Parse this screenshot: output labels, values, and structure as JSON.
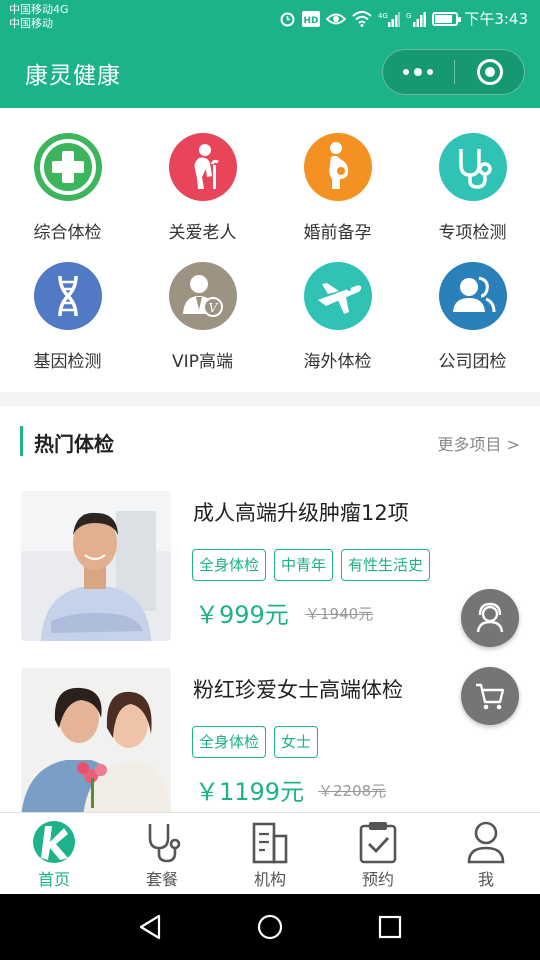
{
  "status_bar": {
    "carrier_line1": "中国移动4G",
    "carrier_line2": "中国移动",
    "time": "下午3:43",
    "battery_level": 0.85,
    "icons": [
      "alarm-icon",
      "hd-icon",
      "eye-icon",
      "wifi-icon",
      "signal-4g-icon",
      "signal-icon",
      "battery-icon"
    ]
  },
  "header": {
    "title": "康灵健康",
    "background": "#1db38a"
  },
  "categories": [
    {
      "label": "综合体检",
      "icon": "medical-cross-icon",
      "color": "#3cb55c"
    },
    {
      "label": "关爱老人",
      "icon": "elderly-icon",
      "color": "#e8445a"
    },
    {
      "label": "婚前备孕",
      "icon": "pregnant-icon",
      "color": "#f39222"
    },
    {
      "label": "专项检测",
      "icon": "stethoscope-icon",
      "color": "#2fc2b5"
    },
    {
      "label": "基因检测",
      "icon": "dna-icon",
      "color": "#5179c4"
    },
    {
      "label": "VIP高端",
      "icon": "vip-user-icon",
      "color": "#9c9382"
    },
    {
      "label": "海外体检",
      "icon": "airplane-icon",
      "color": "#2fc2b5"
    },
    {
      "label": "公司团检",
      "icon": "group-icon",
      "color": "#2a80b9"
    }
  ],
  "hot": {
    "title": "热门体检",
    "more": "更多项目 >",
    "products": [
      {
        "name": "成人高端升级肿瘤12项",
        "tags": [
          "全身体检",
          "中青年",
          "有性生活史"
        ],
        "price": "￥999元",
        "old_price": "￥1940元"
      },
      {
        "name": "粉红珍爱女士高端体检",
        "tags": [
          "全身体检",
          "女士"
        ],
        "price": "￥1199元",
        "old_price": "￥2208元"
      }
    ]
  },
  "floating": {
    "service": "customer-service-icon",
    "cart": "cart-icon"
  },
  "tabs": [
    {
      "label": "首页",
      "icon": "home-logo-icon",
      "active": true
    },
    {
      "label": "套餐",
      "icon": "stethoscope-icon",
      "active": false
    },
    {
      "label": "机构",
      "icon": "building-icon",
      "active": false
    },
    {
      "label": "预约",
      "icon": "clipboard-check-icon",
      "active": false
    },
    {
      "label": "我",
      "icon": "person-icon",
      "active": false
    }
  ],
  "accent_color": "#1db38a"
}
